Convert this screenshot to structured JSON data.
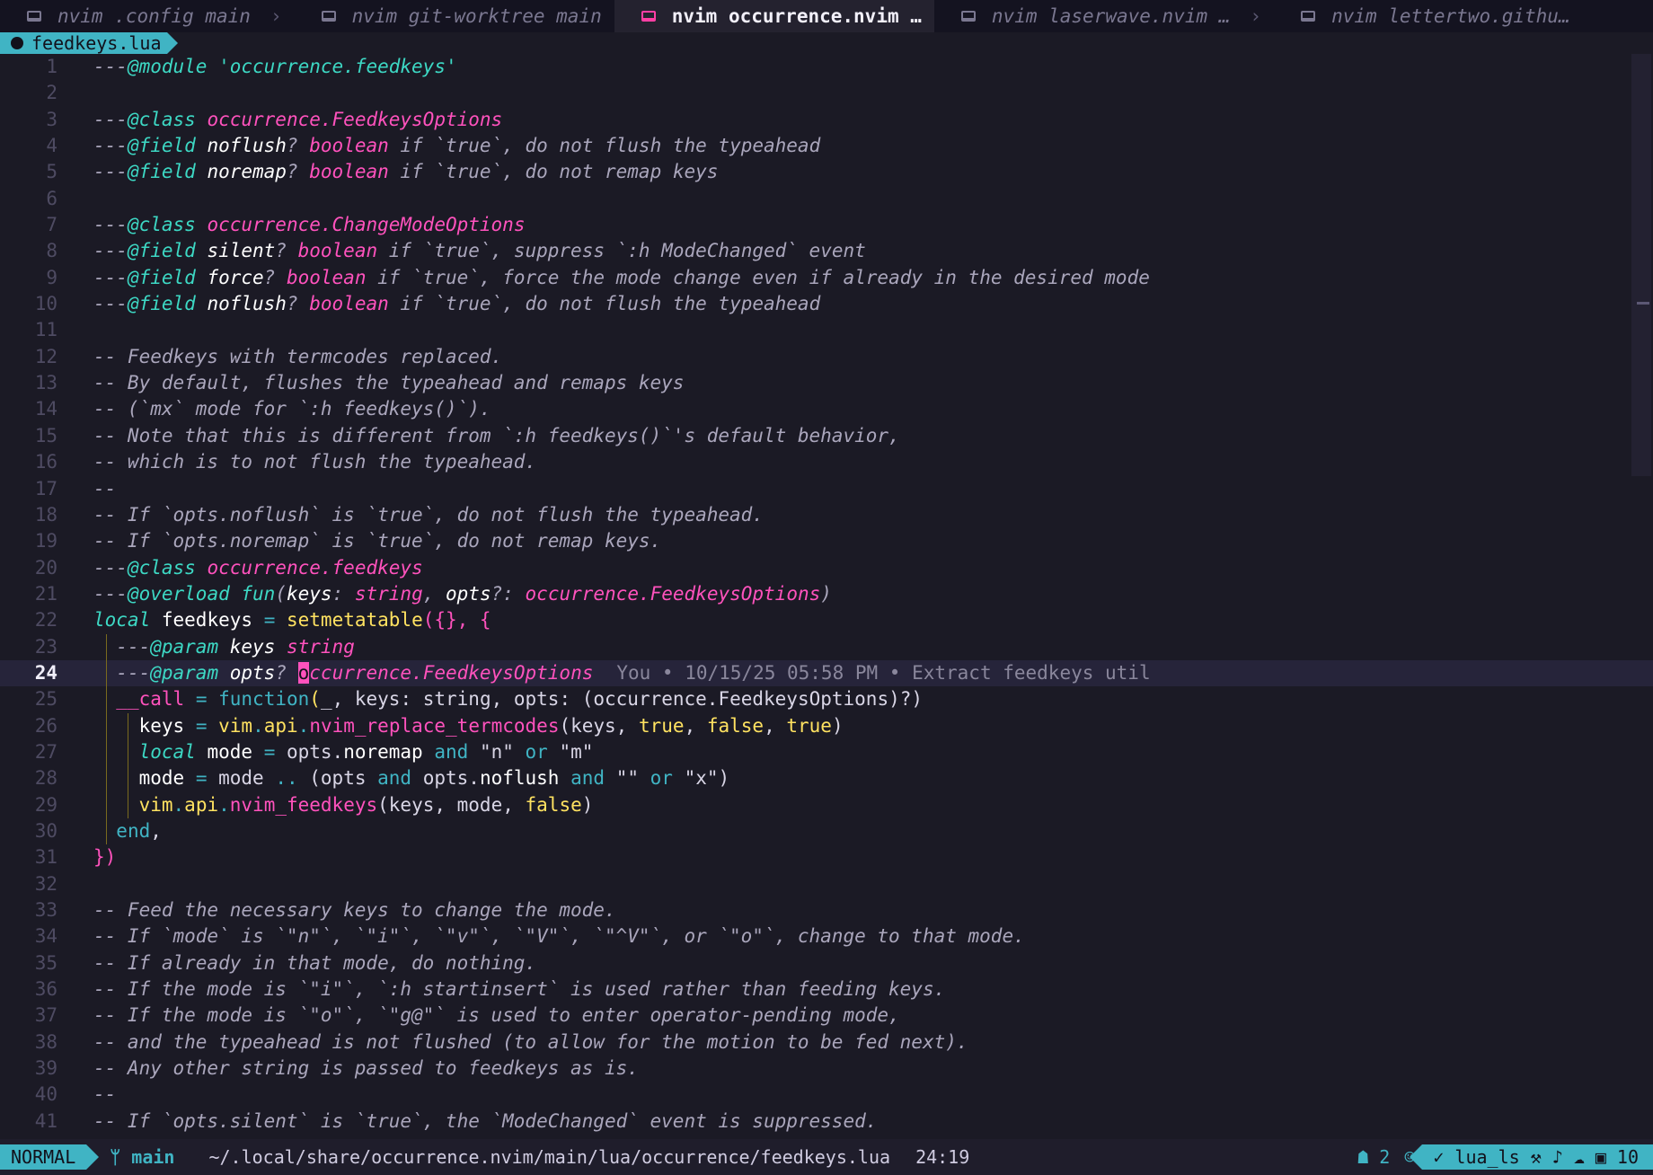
{
  "tabs": [
    {
      "label": "nvim .config main",
      "active": false
    },
    {
      "label": "nvim git-worktree main",
      "active": false
    },
    {
      "label": "nvim occurrence.nvim …",
      "active": true
    },
    {
      "label": "nvim laserwave.nvim …",
      "active": false
    },
    {
      "label": "nvim lettertwo.githu…",
      "active": false
    }
  ],
  "file_tab": {
    "label": "feedkeys.lua"
  },
  "blame": "You • 10/15/25 05:58 PM • Extract feedkeys util",
  "cursor_line": 24,
  "lines": [
    {
      "n": "1",
      "segs": [
        [
          "c",
          "---"
        ],
        [
          "t",
          "@module"
        ],
        [
          "s",
          " "
        ],
        [
          "t",
          "'occurrence.feedkeys'"
        ]
      ]
    },
    {
      "n": "2",
      "segs": []
    },
    {
      "n": "3",
      "segs": [
        [
          "c",
          "---"
        ],
        [
          "t",
          "@class"
        ],
        [
          "s",
          " "
        ],
        [
          "m",
          "occurrence.FeedkeysOptions"
        ]
      ]
    },
    {
      "n": "4",
      "segs": [
        [
          "c",
          "---"
        ],
        [
          "t",
          "@field"
        ],
        [
          "s",
          " "
        ],
        [
          "v",
          "noflush"
        ],
        [
          "c",
          "? "
        ],
        [
          "m",
          "boolean"
        ],
        [
          "c",
          " if `true`, do not flush the typeahead"
        ]
      ]
    },
    {
      "n": "5",
      "segs": [
        [
          "c",
          "---"
        ],
        [
          "t",
          "@field"
        ],
        [
          "s",
          " "
        ],
        [
          "v",
          "noremap"
        ],
        [
          "c",
          "? "
        ],
        [
          "m",
          "boolean"
        ],
        [
          "c",
          " if `true`, do not remap keys"
        ]
      ]
    },
    {
      "n": "6",
      "segs": []
    },
    {
      "n": "7",
      "segs": [
        [
          "c",
          "---"
        ],
        [
          "t",
          "@class"
        ],
        [
          "s",
          " "
        ],
        [
          "m",
          "occurrence.ChangeModeOptions"
        ]
      ]
    },
    {
      "n": "8",
      "segs": [
        [
          "c",
          "---"
        ],
        [
          "t",
          "@field"
        ],
        [
          "s",
          " "
        ],
        [
          "v",
          "silent"
        ],
        [
          "c",
          "? "
        ],
        [
          "m",
          "boolean"
        ],
        [
          "c",
          " if `true`, suppress `:h ModeChanged` event"
        ]
      ]
    },
    {
      "n": "9",
      "segs": [
        [
          "c",
          "---"
        ],
        [
          "t",
          "@field"
        ],
        [
          "s",
          " "
        ],
        [
          "v",
          "force"
        ],
        [
          "c",
          "? "
        ],
        [
          "m",
          "boolean"
        ],
        [
          "c",
          " if `true`, force the mode change even if already in the desired mode"
        ]
      ]
    },
    {
      "n": "10",
      "segs": [
        [
          "c",
          "---"
        ],
        [
          "t",
          "@field"
        ],
        [
          "s",
          " "
        ],
        [
          "v",
          "noflush"
        ],
        [
          "c",
          "? "
        ],
        [
          "m",
          "boolean"
        ],
        [
          "c",
          " if `true`, do not flush the typeahead"
        ]
      ]
    },
    {
      "n": "11",
      "segs": []
    },
    {
      "n": "12",
      "segs": [
        [
          "c",
          "-- Feedkeys with termcodes replaced."
        ]
      ]
    },
    {
      "n": "13",
      "segs": [
        [
          "c",
          "-- By default, flushes the typeahead and remaps keys"
        ]
      ]
    },
    {
      "n": "14",
      "segs": [
        [
          "c",
          "-- (`mx` mode for `:h feedkeys()`)."
        ]
      ]
    },
    {
      "n": "15",
      "segs": [
        [
          "c",
          "-- Note that this is different from `:h feedkeys()`'s default behavior,"
        ]
      ]
    },
    {
      "n": "16",
      "segs": [
        [
          "c",
          "-- which is to not flush the typeahead."
        ]
      ]
    },
    {
      "n": "17",
      "segs": [
        [
          "c",
          "--"
        ]
      ]
    },
    {
      "n": "18",
      "segs": [
        [
          "c",
          "-- If `opts.noflush` is `true`, do not flush the typeahead."
        ]
      ]
    },
    {
      "n": "19",
      "segs": [
        [
          "c",
          "-- If `opts.noremap` is `true`, do not remap keys."
        ]
      ]
    },
    {
      "n": "20",
      "segs": [
        [
          "c",
          "---"
        ],
        [
          "t",
          "@class"
        ],
        [
          "s",
          " "
        ],
        [
          "m",
          "occurrence.feedkeys"
        ]
      ]
    },
    {
      "n": "21",
      "segs": [
        [
          "c",
          "---"
        ],
        [
          "t",
          "@overload"
        ],
        [
          "s",
          " "
        ],
        [
          "t",
          "fun"
        ],
        [
          "c",
          "("
        ],
        [
          "v",
          "keys"
        ],
        [
          "c",
          ": "
        ],
        [
          "m",
          "string"
        ],
        [
          "c",
          ", "
        ],
        [
          "v",
          "opts"
        ],
        [
          "c",
          "?: "
        ],
        [
          "m",
          "occurrence.FeedkeysOptions"
        ],
        [
          "c",
          ")"
        ]
      ]
    },
    {
      "n": "22",
      "segs": [
        [
          "t",
          "local"
        ],
        [
          "s",
          " "
        ],
        [
          "w",
          "feedkeys"
        ],
        [
          "s",
          " "
        ],
        [
          "kw",
          "="
        ],
        [
          "s",
          " "
        ],
        [
          "y",
          "setmetatable"
        ],
        [
          "p",
          "({}, {"
        ]
      ]
    },
    {
      "n": "23",
      "segs": [
        [
          "s",
          "  "
        ],
        [
          "c",
          "---"
        ],
        [
          "t",
          "@param"
        ],
        [
          "s",
          " "
        ],
        [
          "v",
          "keys"
        ],
        [
          "s",
          " "
        ],
        [
          "m",
          "string"
        ]
      ]
    },
    {
      "n": "24",
      "segs": [
        [
          "s",
          "  "
        ],
        [
          "c",
          "---"
        ],
        [
          "t",
          "@param"
        ],
        [
          "s",
          " "
        ],
        [
          "v",
          "opts"
        ],
        [
          "c",
          "? "
        ],
        [
          "cur",
          "o"
        ],
        [
          "m",
          "ccurrence.FeedkeysOptions"
        ]
      ]
    },
    {
      "n": "25",
      "segs": [
        [
          "s",
          "  "
        ],
        [
          "p",
          "__call"
        ],
        [
          "s",
          " "
        ],
        [
          "kw",
          "="
        ],
        [
          "s",
          " "
        ],
        [
          "kw",
          "function"
        ],
        [
          "y",
          "("
        ],
        [
          "s",
          "_, keys: string, opts: (occurrence.FeedkeysOptions)?)"
        ]
      ]
    },
    {
      "n": "26",
      "segs": [
        [
          "s",
          "    "
        ],
        [
          "w",
          "keys"
        ],
        [
          "s",
          " "
        ],
        [
          "kw",
          "="
        ],
        [
          "s",
          " "
        ],
        [
          "y",
          "vim"
        ],
        [
          "kw",
          "."
        ],
        [
          "y",
          "api"
        ],
        [
          "kw",
          "."
        ],
        [
          "fn",
          "nvim_replace_termcodes"
        ],
        [
          "s",
          "(keys, "
        ],
        [
          "y",
          "true"
        ],
        [
          "s",
          ", "
        ],
        [
          "y",
          "false"
        ],
        [
          "s",
          ", "
        ],
        [
          "y",
          "true"
        ],
        [
          "s",
          ")"
        ]
      ]
    },
    {
      "n": "27",
      "segs": [
        [
          "s",
          "    "
        ],
        [
          "t",
          "local"
        ],
        [
          "s",
          " "
        ],
        [
          "w",
          "mode"
        ],
        [
          "s",
          " "
        ],
        [
          "kw",
          "="
        ],
        [
          "s",
          " opts."
        ],
        [
          "w",
          "noremap"
        ],
        [
          "s",
          " "
        ],
        [
          "kw",
          "and"
        ],
        [
          "s",
          " \"n\" "
        ],
        [
          "kw",
          "or"
        ],
        [
          "s",
          " \"m\""
        ]
      ]
    },
    {
      "n": "28",
      "segs": [
        [
          "s",
          "    "
        ],
        [
          "w",
          "mode"
        ],
        [
          "s",
          " "
        ],
        [
          "kw",
          "="
        ],
        [
          "s",
          " mode "
        ],
        [
          "kw",
          ".."
        ],
        [
          "s",
          " (opts "
        ],
        [
          "kw",
          "and"
        ],
        [
          "s",
          " opts."
        ],
        [
          "w",
          "noflush"
        ],
        [
          "s",
          " "
        ],
        [
          "kw",
          "and"
        ],
        [
          "s",
          " \"\" "
        ],
        [
          "kw",
          "or"
        ],
        [
          "s",
          " \"x\")"
        ]
      ]
    },
    {
      "n": "29",
      "segs": [
        [
          "s",
          "    "
        ],
        [
          "y",
          "vim"
        ],
        [
          "kw",
          "."
        ],
        [
          "y",
          "api"
        ],
        [
          "kw",
          "."
        ],
        [
          "fn",
          "nvim_feedkeys"
        ],
        [
          "s",
          "(keys, mode, "
        ],
        [
          "y",
          "false"
        ],
        [
          "s",
          ")"
        ]
      ]
    },
    {
      "n": "30",
      "segs": [
        [
          "s",
          "  "
        ],
        [
          "kw",
          "end"
        ],
        [
          "s",
          ","
        ]
      ]
    },
    {
      "n": "31",
      "segs": [
        [
          "p",
          "})"
        ]
      ]
    },
    {
      "n": "32",
      "segs": []
    },
    {
      "n": "33",
      "segs": [
        [
          "c",
          "-- Feed the necessary keys to change the mode."
        ]
      ]
    },
    {
      "n": "34",
      "segs": [
        [
          "c",
          "-- If `mode` is `\"n\"`, `\"i\"`, `\"v\"`, `\"V\"`, `\"^V\"`, or `\"o\"`, change to that mode."
        ]
      ]
    },
    {
      "n": "35",
      "segs": [
        [
          "c",
          "-- If already in that mode, do nothing."
        ]
      ]
    },
    {
      "n": "36",
      "segs": [
        [
          "c",
          "-- If the mode is `\"i\"`, `:h startinsert` is used rather than feeding keys."
        ]
      ]
    },
    {
      "n": "37",
      "segs": [
        [
          "c",
          "-- If the mode is `\"o\"`, `\"g@\"` is used to enter operator-pending mode,"
        ]
      ]
    },
    {
      "n": "38",
      "segs": [
        [
          "c",
          "-- and the typeahead is not flushed (to allow for the motion to be fed next)."
        ]
      ]
    },
    {
      "n": "39",
      "segs": [
        [
          "c",
          "-- Any other string is passed to feedkeys as is."
        ]
      ]
    },
    {
      "n": "40",
      "segs": [
        [
          "c",
          "--"
        ]
      ]
    },
    {
      "n": "41",
      "segs": [
        [
          "c",
          "-- If `opts.silent` is `true`, the `ModeChanged` event is suppressed."
        ]
      ]
    }
  ],
  "status": {
    "mode": "NORMAL",
    "branch": "main",
    "path": "~/.local/share/occurrence.nvim/main/lua/occurrence/feedkeys.lua",
    "position": "24:19",
    "diagnostics_count": "2",
    "lsp": "lua_ls",
    "extra_count": "10"
  }
}
